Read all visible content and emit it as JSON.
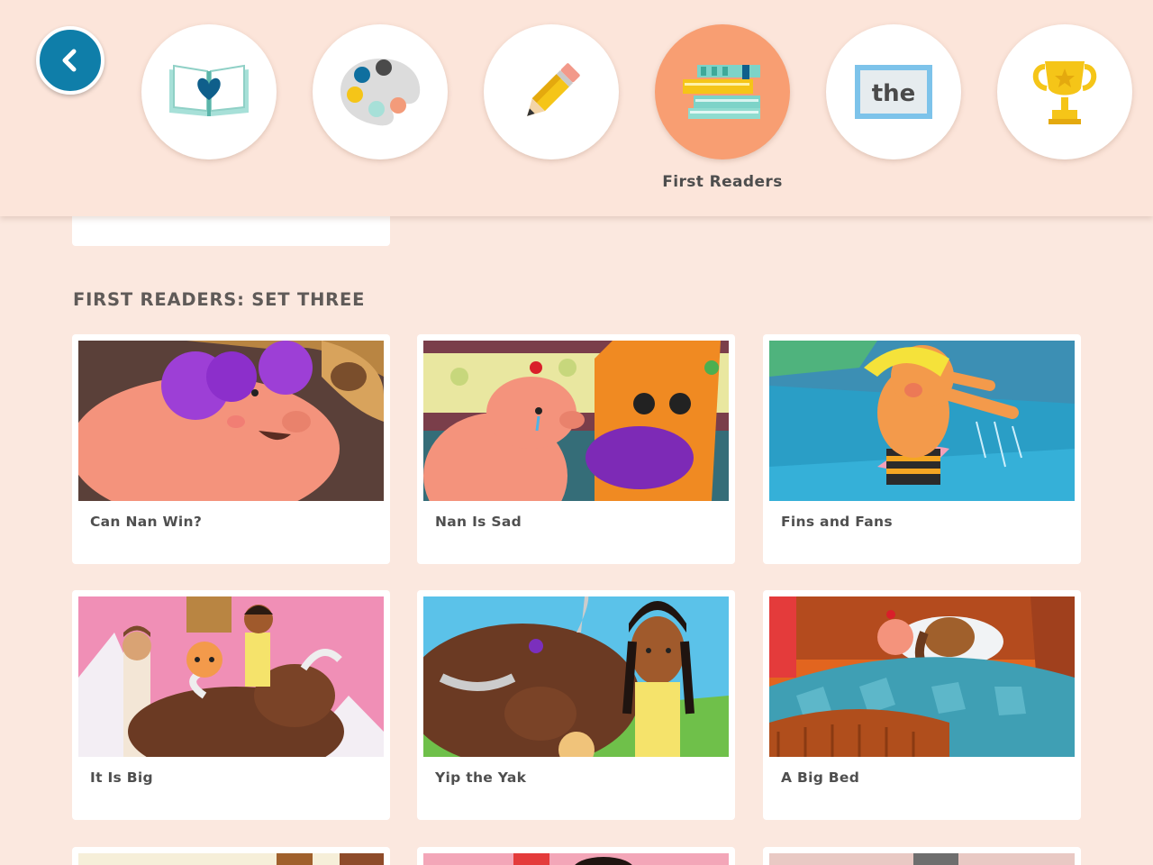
{
  "header": {
    "back_icon": "chevron-left-icon",
    "nav_items": [
      {
        "icon": "book-heart-icon",
        "label": ""
      },
      {
        "icon": "palette-icon",
        "label": ""
      },
      {
        "icon": "pencil-icon",
        "label": ""
      },
      {
        "icon": "books-stack-icon",
        "label": "First Readers",
        "active": true
      },
      {
        "icon": "sight-word-the-icon",
        "label": "",
        "word": "the"
      },
      {
        "icon": "trophy-icon",
        "label": ""
      }
    ]
  },
  "section": {
    "title": "FIRST READERS: SET THREE",
    "books": [
      {
        "title": "Can Nan Win?"
      },
      {
        "title": "Nan Is Sad"
      },
      {
        "title": "Fins and Fans"
      },
      {
        "title": "It Is Big"
      },
      {
        "title": "Yip the Yak"
      },
      {
        "title": "A Big Bed"
      }
    ]
  },
  "colors": {
    "background": "#fbe8df",
    "header": "#fce5da",
    "active_nav": "#f89e72",
    "back_button": "#0f7ea9"
  }
}
